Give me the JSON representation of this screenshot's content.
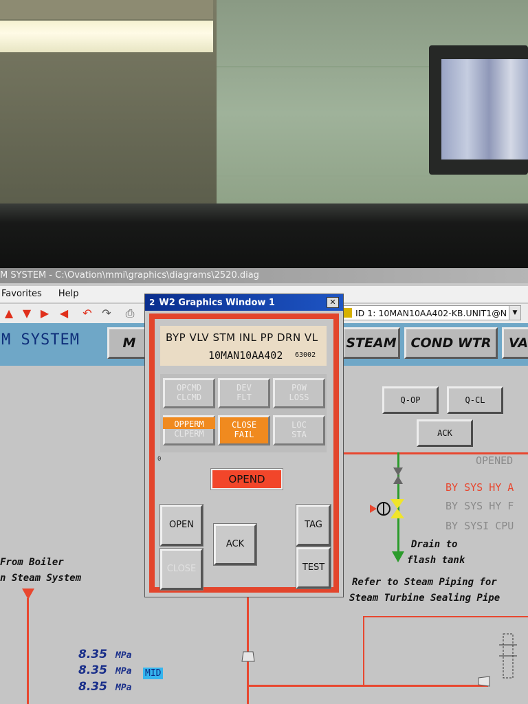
{
  "window": {
    "title": "M SYSTEM - C:\\Ovation\\mmi\\graphics\\diagrams\\2520.diag",
    "menu": [
      "Favorites",
      "Help"
    ],
    "id_combo": "ID 1: 10MAN10AA402-KB.UNIT1@N"
  },
  "toolbar": {
    "icons": [
      "up-arrow-icon",
      "down-arrow-icon",
      "right-arrow-icon",
      "left-arrow-icon",
      "back-icon",
      "forward-icon",
      "print-icon"
    ]
  },
  "diagram": {
    "system_title": "M SYSTEM",
    "nav_buttons": [
      "M",
      "STEAM",
      "COND WTR",
      "VA"
    ],
    "valve_buttons": {
      "q_op": "Q-OP",
      "q_cl": "Q-CL",
      "ack": "ACK"
    },
    "status": {
      "opened": "OPENED",
      "by_sys_hy_a": "BY SYS HY A",
      "by_sys_hy_b": "BY SYS HY F",
      "by_sys_cpu": "BY SYSI CPU"
    },
    "drain_note": [
      "Drain to",
      "flash tank"
    ],
    "refer_note": [
      "Refer to Steam Piping for",
      "Steam Turbine Sealing Pipe"
    ],
    "boiler_note": [
      "From Boiler",
      "n Steam System"
    ],
    "readings": [
      {
        "value": "8.35",
        "unit": "MPa"
      },
      {
        "value": "8.35",
        "unit": "MPa"
      },
      {
        "value": "8.35",
        "unit": "MPa"
      }
    ],
    "mid_badge": "MID",
    "colors": {
      "accent_red": "#e8472f",
      "drain_green": "#2b9b2b",
      "nav_strip": "#6fa7c7",
      "value_blue": "#1a2f8a"
    }
  },
  "popup": {
    "number": "2",
    "title": "W2 Graphics Window 1",
    "close": "✕",
    "header_line1": "BYP VLV STM INL PP DRN VL",
    "header_tag": "10MAN10AA402",
    "header_code": "63002",
    "grid": [
      {
        "top": "OPCMD",
        "bottom": "CLCMD",
        "active": false
      },
      {
        "top": "DEV",
        "bottom": "FLT",
        "active": false
      },
      {
        "top": "POW",
        "bottom": "LOSS",
        "active": false
      },
      {
        "top": "OPPERM",
        "bottom": "CLPERM",
        "active": true
      },
      {
        "top": "CLOSE",
        "bottom": "FAIL",
        "active": true
      },
      {
        "top": "LOC",
        "bottom": "STA",
        "active": false
      }
    ],
    "zero_label": "0",
    "state": "OPEND",
    "buttons": {
      "open": "OPEN",
      "close": "CLOSE",
      "ack": "ACK",
      "tag": "TAG",
      "test": "TEST"
    }
  }
}
